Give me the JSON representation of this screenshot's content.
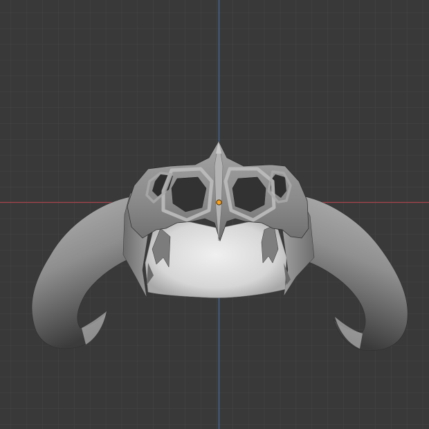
{
  "viewport": {
    "view": "front-orthographic",
    "object": "skull-helmet-mesh",
    "colors": {
      "background": "#393939",
      "grid_minor": "#444444",
      "grid_major": "#4c4c4c",
      "x_axis": "#a8424d",
      "z_axis": "#4a6fa8",
      "origin_dot": "#ffa117",
      "mesh_light": "#e6e6e6",
      "mesh_mid": "#9a9a9a",
      "mesh_dark": "#3e3e3e"
    },
    "icons": [
      "object-origin-icon"
    ]
  }
}
